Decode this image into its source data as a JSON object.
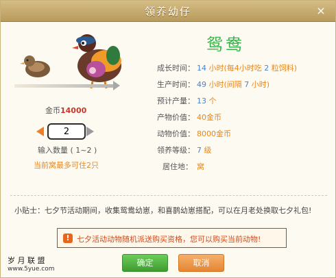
{
  "dialog": {
    "title": "领养幼仔",
    "close_label": "×"
  },
  "animal": {
    "name": "鸳鸯",
    "gold_label": "金币",
    "gold_value": "14000",
    "quantity_value": "2",
    "quantity_label": "输入数量 ( 1~2 )",
    "nest_note": "当前窝最多可住2只"
  },
  "info": [
    {
      "key": "成长时间：",
      "parts": [
        "14",
        " 小时(每4小时吃 ",
        "2",
        " 粒饲料)"
      ]
    },
    {
      "key": "生产时间：",
      "parts": [
        "49",
        " 小时(间隔 ",
        "7",
        " 小时)"
      ]
    },
    {
      "key": "预计产量：",
      "parts": [
        "13",
        " 个"
      ]
    },
    {
      "key": "产物价值：",
      "parts": [
        "40金币"
      ]
    },
    {
      "key": "动物价值：",
      "parts": [
        "8000金币"
      ]
    },
    {
      "key": "领养等级：",
      "parts": [
        "7",
        "  级"
      ]
    },
    {
      "key": "居住地：",
      "parts": [
        "窝"
      ]
    }
  ],
  "tip": "小贴士：七夕节活动期间，收集鸳鸯幼崽，和喜鹊幼崽搭配，可以在月老处换取七夕礼包!",
  "alert": {
    "icon": "alert-icon",
    "text": "七夕活动动物随机派送购买资格，您可以购买当前动物!"
  },
  "buttons": {
    "ok": "确定",
    "cancel": "取消"
  },
  "watermark": {
    "main": "岁 月 联 盟",
    "sub": "www.5yue.com"
  },
  "colors": {
    "accent_orange": "#e8861c",
    "title_green": "#36b34a",
    "alert_red": "#e02a2a"
  }
}
